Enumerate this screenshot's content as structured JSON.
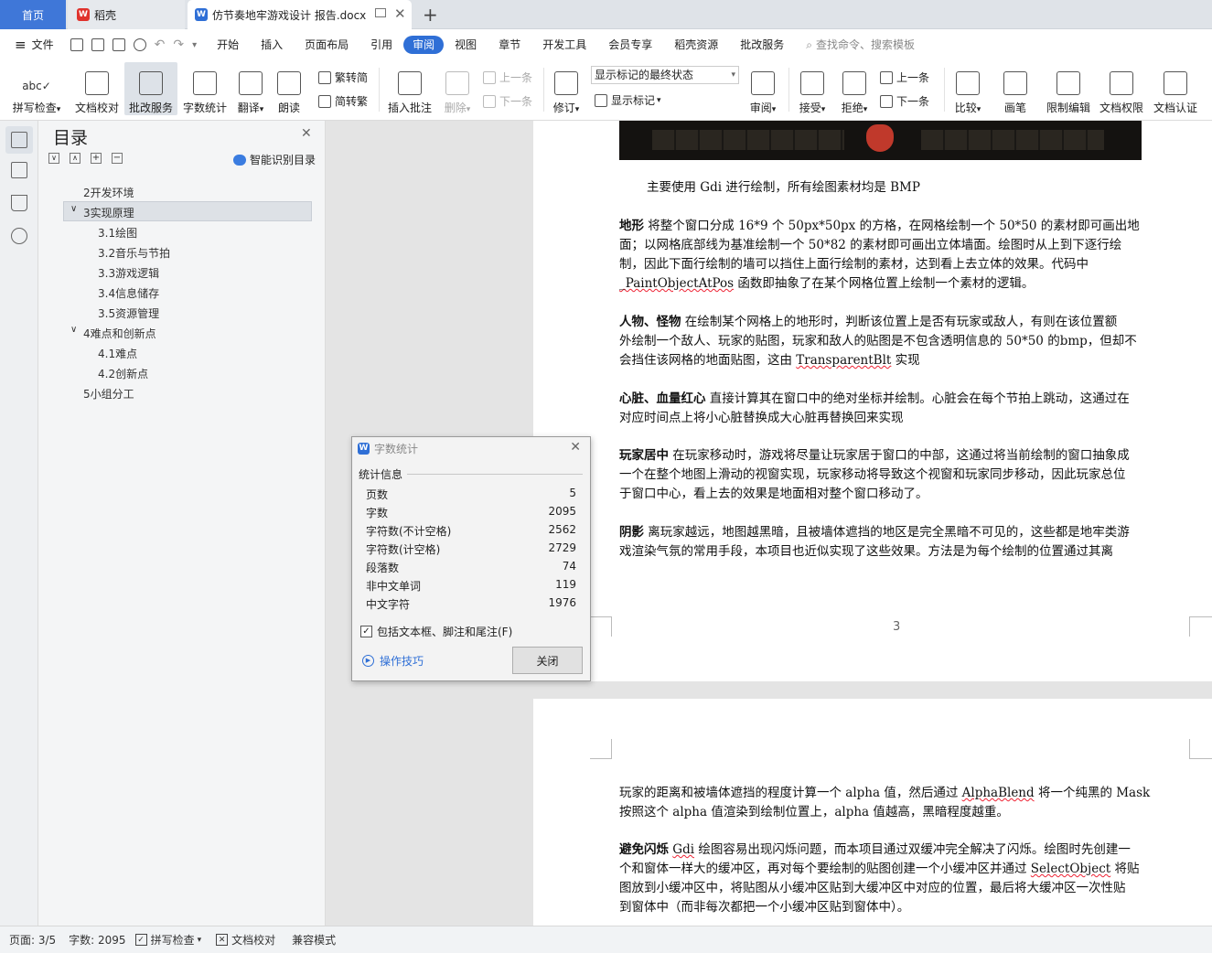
{
  "tabs": {
    "home": "首页",
    "daoke": "稻壳",
    "document": "仿节奏地牢游戏设计 报告.docx",
    "add": "+"
  },
  "menu": {
    "file": "文件",
    "items": [
      "开始",
      "插入",
      "页面布局",
      "引用",
      "审阅",
      "视图",
      "章节",
      "开发工具",
      "会员专享",
      "稻壳资源",
      "批改服务"
    ],
    "active": "审阅",
    "search_placeholder": "查找命令、搜索模板"
  },
  "toolbar": {
    "spell_check": "拼写检查",
    "doc_proofread": "文档校对",
    "correction_service": "批改服务",
    "word_count": "字数统计",
    "translate": "翻译",
    "read_aloud": "朗读",
    "trad_to_simp": "繁转简",
    "simp_to_trad": "简转繁",
    "insert_comment": "插入批注",
    "delete": "删除",
    "prev_comment": "上一条",
    "next_comment": "下一条",
    "track_changes": "修订",
    "markup_state": "显示标记的最终状态",
    "show_markup": "显示标记",
    "review": "审阅",
    "accept": "接受",
    "reject": "拒绝",
    "prev_change": "上一条",
    "next_change": "下一条",
    "compare": "比较",
    "pen": "画笔",
    "restrict_editing": "限制编辑",
    "doc_permission": "文档权限",
    "doc_certification": "文档认证"
  },
  "toc": {
    "title": "目录",
    "smart_toc": "智能识别目录",
    "items": [
      {
        "label": "2开发环境",
        "level": 1
      },
      {
        "label": "3实现原理",
        "level": 1
      },
      {
        "label": "3.1绘图",
        "level": 2
      },
      {
        "label": "3.2音乐与节拍",
        "level": 2
      },
      {
        "label": "3.3游戏逻辑",
        "level": 2
      },
      {
        "label": "3.4信息储存",
        "level": 2
      },
      {
        "label": "3.5资源管理",
        "level": 2
      },
      {
        "label": "4难点和创新点",
        "level": 1
      },
      {
        "label": "4.1难点",
        "level": 2
      },
      {
        "label": "4.2创新点",
        "level": 2
      },
      {
        "label": "5小组分工",
        "level": 1
      }
    ],
    "selected": "3实现原理"
  },
  "document": {
    "p0": "主要使用 Gdi 进行绘制，所有绘图素材均是 BMP",
    "p1_bold": "地形",
    "p1_l1": " 将整个窗口分成 16*9 个 50px*50px 的方格，在网格绘制一个 50*50 的素材即可画出地",
    "p1_l2": "面；以网格底部线为基准绘制一个 50*82 的素材即可画出立体墙面。绘图时从上到下逐行绘",
    "p1_l3": "制，因此下面行绘制的墙可以挡住上面行绘制的素材，达到看上去立体的效果。代码中",
    "p1_l4_code": "_PaintObjectAtPos",
    "p1_l4": " 函数即抽象了在某个网格位置上绘制一个素材的逻辑。",
    "p2_bold": "人物、怪物",
    "p2_l1": " 在绘制某个网格上的地形时，判断该位置上是否有玩家或敌人，有则在该位置额",
    "p2_l2": "外绘制一个敌人、玩家的贴图，玩家和敌人的贴图是不包含透明信息的 50*50 的bmp，但却不",
    "p2_l3a": "会挡住该网格的地面贴图，这由 ",
    "p2_l3_code": "TransparentBlt",
    "p2_l3b": " 实现",
    "p3_bold": "心脏、血量红心",
    "p3_l1": " 直接计算其在窗口中的绝对坐标并绘制。心脏会在每个节拍上跳动，这通过在",
    "p3_l2": "对应时间点上将小心脏替换成大心脏再替换回来实现",
    "p4_bold": "玩家居中",
    "p4_l1": " 在玩家移动时，游戏将尽量让玩家居于窗口的中部，这通过将当前绘制的窗口抽象成",
    "p4_l2": "一个在整个地图上滑动的视窗实现，玩家移动将导致这个视窗和玩家同步移动，因此玩家总位",
    "p4_l3": "于窗口中心，看上去的效果是地面相对整个窗口移动了。",
    "p5_bold": "阴影",
    "p5_l1": " 离玩家越远，地图越黑暗，且被墙体遮挡的地区是完全黑暗不可见的，这些都是地牢类游",
    "p5_l2": "戏渲染气氛的常用手段，本项目也近似实现了这些效果。方法是为每个绘制的位置通过其离",
    "page_number": "3",
    "p6_l1a": "玩家的距离和被墙体遮挡的程度计算一个 alpha 值，然后通过 ",
    "p6_l1_code": "AlphaBlend",
    "p6_l1b": " 将一个纯黑的 Mask",
    "p6_l2": "按照这个 alpha 值渲染到绘制位置上，alpha 值越高，黑暗程度越重。",
    "p7_bold": "避免闪烁",
    "p7_l1a": " ",
    "p7_l1_code": "Gdi",
    "p7_l1b": " 绘图容易出现闪烁问题，而本项目通过双缓冲完全解决了闪烁。绘图时先创建一",
    "p7_l2a": "个和窗体一样大的缓冲区，再对每个要绘制的贴图创建一个小缓冲区并通过 ",
    "p7_l2_code": "SelectObject",
    "p7_l2b": " 将贴",
    "p7_l3": "图放到小缓冲区中，将贴图从小缓冲区贴到大缓冲区中对应的位置，最后将大缓冲区一次性贴",
    "p7_l4": "到窗体中（而非每次都把一个小缓冲区贴到窗体中）。"
  },
  "dialog": {
    "title": "字数统计",
    "section": "统计信息",
    "rows": [
      {
        "label": "页数",
        "value": "5"
      },
      {
        "label": "字数",
        "value": "2095"
      },
      {
        "label": "字符数(不计空格)",
        "value": "2562"
      },
      {
        "label": "字符数(计空格)",
        "value": "2729"
      },
      {
        "label": "段落数",
        "value": "74"
      },
      {
        "label": "非中文单词",
        "value": "119"
      },
      {
        "label": "中文字符",
        "value": "1976"
      }
    ],
    "checkbox_label": "包括文本框、脚注和尾注(F)",
    "checkbox_checked": true,
    "tips_link": "操作技巧",
    "close_button": "关闭"
  },
  "statusbar": {
    "page": "页面: 3/5",
    "word_count": "字数: 2095",
    "spell_check": "拼写检查",
    "doc_proofread": "文档校对",
    "compat_mode": "兼容模式"
  },
  "colors": {
    "accent": "#2f6fd6",
    "home_tab": "#3f77d8",
    "wps_red": "#e0322c"
  }
}
